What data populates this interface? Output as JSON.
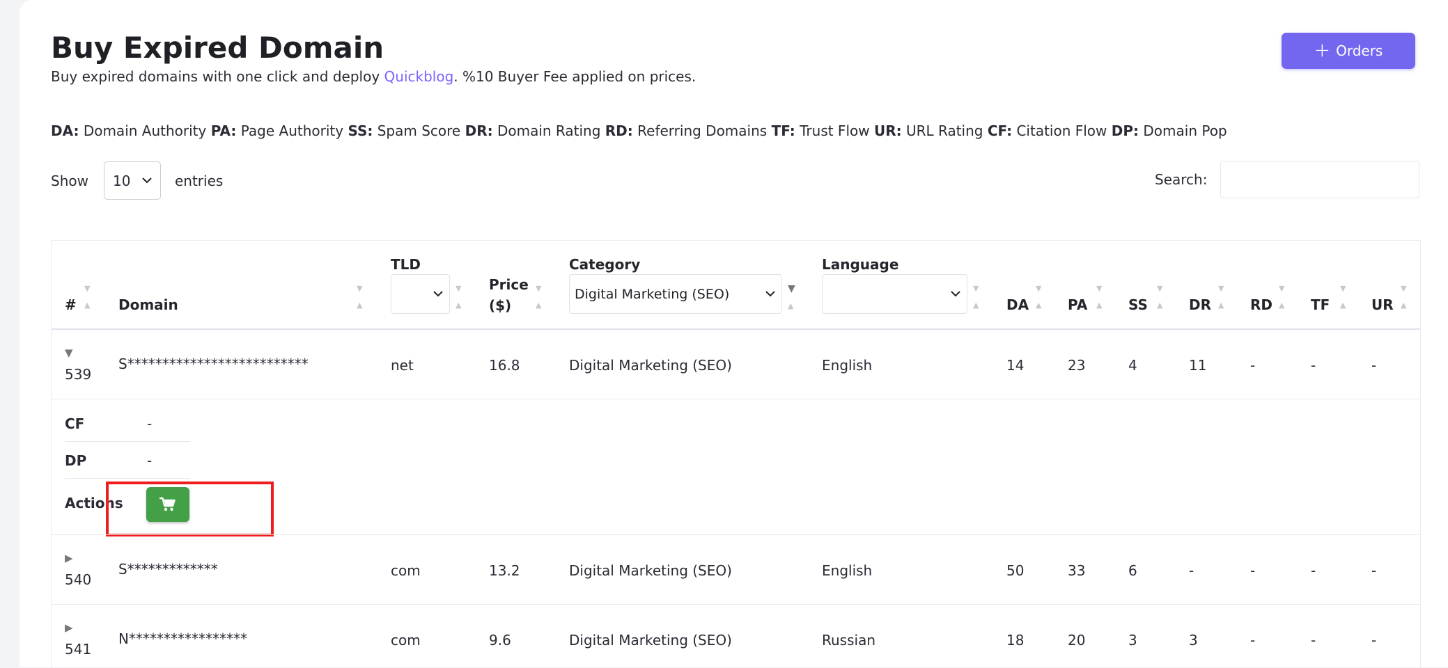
{
  "header": {
    "title": "Buy Expired Domain",
    "subtitle_prefix": "Buy expired domains with one click and deploy ",
    "subtitle_link": "Quickblog",
    "subtitle_suffix": ". %10 Buyer Fee applied on prices.",
    "orders_button": "Orders"
  },
  "legend": [
    {
      "abbr": "DA:",
      "text": "Domain Authority"
    },
    {
      "abbr": "PA:",
      "text": "Page Authority"
    },
    {
      "abbr": "SS:",
      "text": "Spam Score"
    },
    {
      "abbr": "DR:",
      "text": "Domain Rating"
    },
    {
      "abbr": "RD:",
      "text": "Referring Domains"
    },
    {
      "abbr": "TF:",
      "text": "Trust Flow"
    },
    {
      "abbr": "UR:",
      "text": "URL Rating"
    },
    {
      "abbr": "CF:",
      "text": "Citation Flow"
    },
    {
      "abbr": "DP:",
      "text": "Domain Pop"
    }
  ],
  "controls": {
    "show_label": "Show",
    "entries_value": "10",
    "entries_label": "entries",
    "search_label": "Search:",
    "search_value": ""
  },
  "table": {
    "columns": {
      "num": "#",
      "domain": "Domain",
      "tld": "TLD",
      "price": "Price ($)",
      "category": "Category",
      "language": "Language",
      "da": "DA",
      "pa": "PA",
      "ss": "SS",
      "dr": "DR",
      "rd": "RD",
      "tf": "TF",
      "ur": "UR"
    },
    "filters": {
      "tld": "",
      "category": "Digital Marketing (SEO)",
      "language": ""
    },
    "rows": [
      {
        "num": "539",
        "domain": "S**************************",
        "tld": "net",
        "price": "16.8",
        "category": "Digital Marketing (SEO)",
        "language": "English",
        "da": "14",
        "pa": "23",
        "ss": "4",
        "dr": "11",
        "rd": "-",
        "tf": "-",
        "ur": "-",
        "expanded": true
      },
      {
        "num": "540",
        "domain": "S*************",
        "tld": "com",
        "price": "13.2",
        "category": "Digital Marketing (SEO)",
        "language": "English",
        "da": "50",
        "pa": "33",
        "ss": "6",
        "dr": "-",
        "rd": "-",
        "tf": "-",
        "ur": "-",
        "expanded": false
      },
      {
        "num": "541",
        "domain": "N*****************",
        "tld": "com",
        "price": "9.6",
        "category": "Digital Marketing (SEO)",
        "language": "Russian",
        "da": "18",
        "pa": "20",
        "ss": "3",
        "dr": "3",
        "rd": "-",
        "tf": "-",
        "ur": "-",
        "expanded": false
      }
    ],
    "details": {
      "cf_label": "CF",
      "cf_value": "-",
      "dp_label": "DP",
      "dp_value": "-",
      "actions_label": "Actions"
    }
  },
  "icons": {
    "orders": "plus-icon",
    "cart": "shopping-cart-icon",
    "expanded": "triangle-down-icon",
    "collapsed": "triangle-right-icon"
  },
  "colors": {
    "accent": "#7367f0",
    "link": "#7b61ff",
    "cart_button": "#43a047",
    "highlight": "#ee1c1c"
  }
}
